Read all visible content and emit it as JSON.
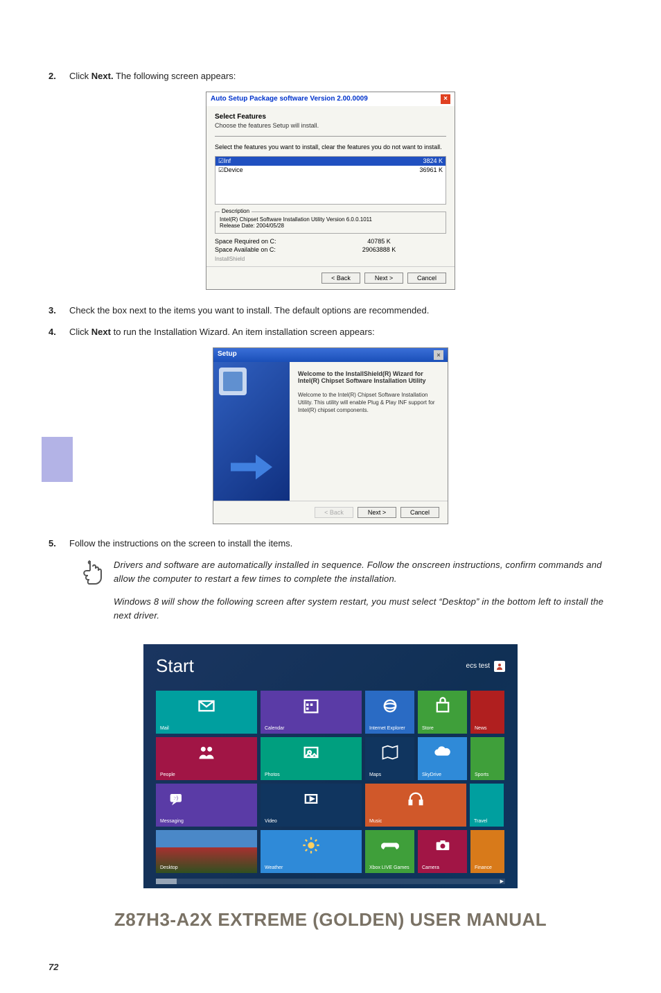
{
  "steps": {
    "s2": {
      "num": "2.",
      "text_before": "Click ",
      "bold": "Next.",
      "text_after": " The following screen appears:"
    },
    "s3": {
      "num": "3.",
      "text": "Check the box next to the items you want to install. The default options are recommended."
    },
    "s4": {
      "num": "4.",
      "text_before": "Click ",
      "bold": "Next",
      "text_after": " to run the Installation Wizard. An item installation screen appears:"
    },
    "s5": {
      "num": "5.",
      "text": "Follow the instructions on the screen to install the items."
    }
  },
  "dialog1": {
    "title": "Auto Setup Package software Version 2.00.0009",
    "section_title": "Select Features",
    "section_sub": "Choose the features Setup will install.",
    "instruction": "Select the features you want to install, clear the features you do not want to install.",
    "feat1_name": "Inf",
    "feat1_size": "3824 K",
    "feat2_name": "Device",
    "feat2_size": "36961 K",
    "desc_label": "Description",
    "desc_line1": "Intel(R) Chipset Software Installation Utility Version 6.0.0.1011",
    "desc_line2": "Release Date:  2004/05/28",
    "space_req_label": "Space Required on  C:",
    "space_req_val": "40785 K",
    "space_avail_label": "Space Available on  C:",
    "space_avail_val": "29063888 K",
    "shield": "InstallShield",
    "btn_back": "< Back",
    "btn_next": "Next >",
    "btn_cancel": "Cancel"
  },
  "dialog2": {
    "title": "Setup",
    "heading": "Welcome to the InstallShield(R) Wizard for Intel(R) Chipset Software Installation Utility",
    "body": "Welcome to the Intel(R) Chipset Software Installation Utility.  This utility will enable Plug & Play INF support for Intel(R) chipset components.",
    "btn_back": "< Back",
    "btn_next": "Next >",
    "btn_cancel": "Cancel"
  },
  "note": {
    "p1": "Drivers and software are automatically installed in sequence. Follow the onscreen instructions, confirm commands and allow the computer to restart a few times to complete the installation.",
    "p2": "Windows 8 will show the following screen after system restart, you must select “Desktop” in the bottom left to install the next driver."
  },
  "win8": {
    "start": "Start",
    "user": "ecs test",
    "tiles": {
      "mail": "Mail",
      "calendar": "Calendar",
      "ie": "Internet Explorer",
      "store": "Store",
      "news": "News",
      "people": "People",
      "photos": "Photos",
      "maps": "Maps",
      "skydrive": "SkyDrive",
      "sports": "Sports",
      "messaging": "Messaging",
      "video": "Video",
      "music": "Music",
      "travel": "Travel",
      "desktop": "Desktop",
      "weather": "Weather",
      "xbox": "Xbox LIVE Games",
      "camera": "Camera",
      "finance": "Finance"
    }
  },
  "footer": "Z87H3-A2X EXTREME (GOLDEN) USER MANUAL",
  "page": "72"
}
